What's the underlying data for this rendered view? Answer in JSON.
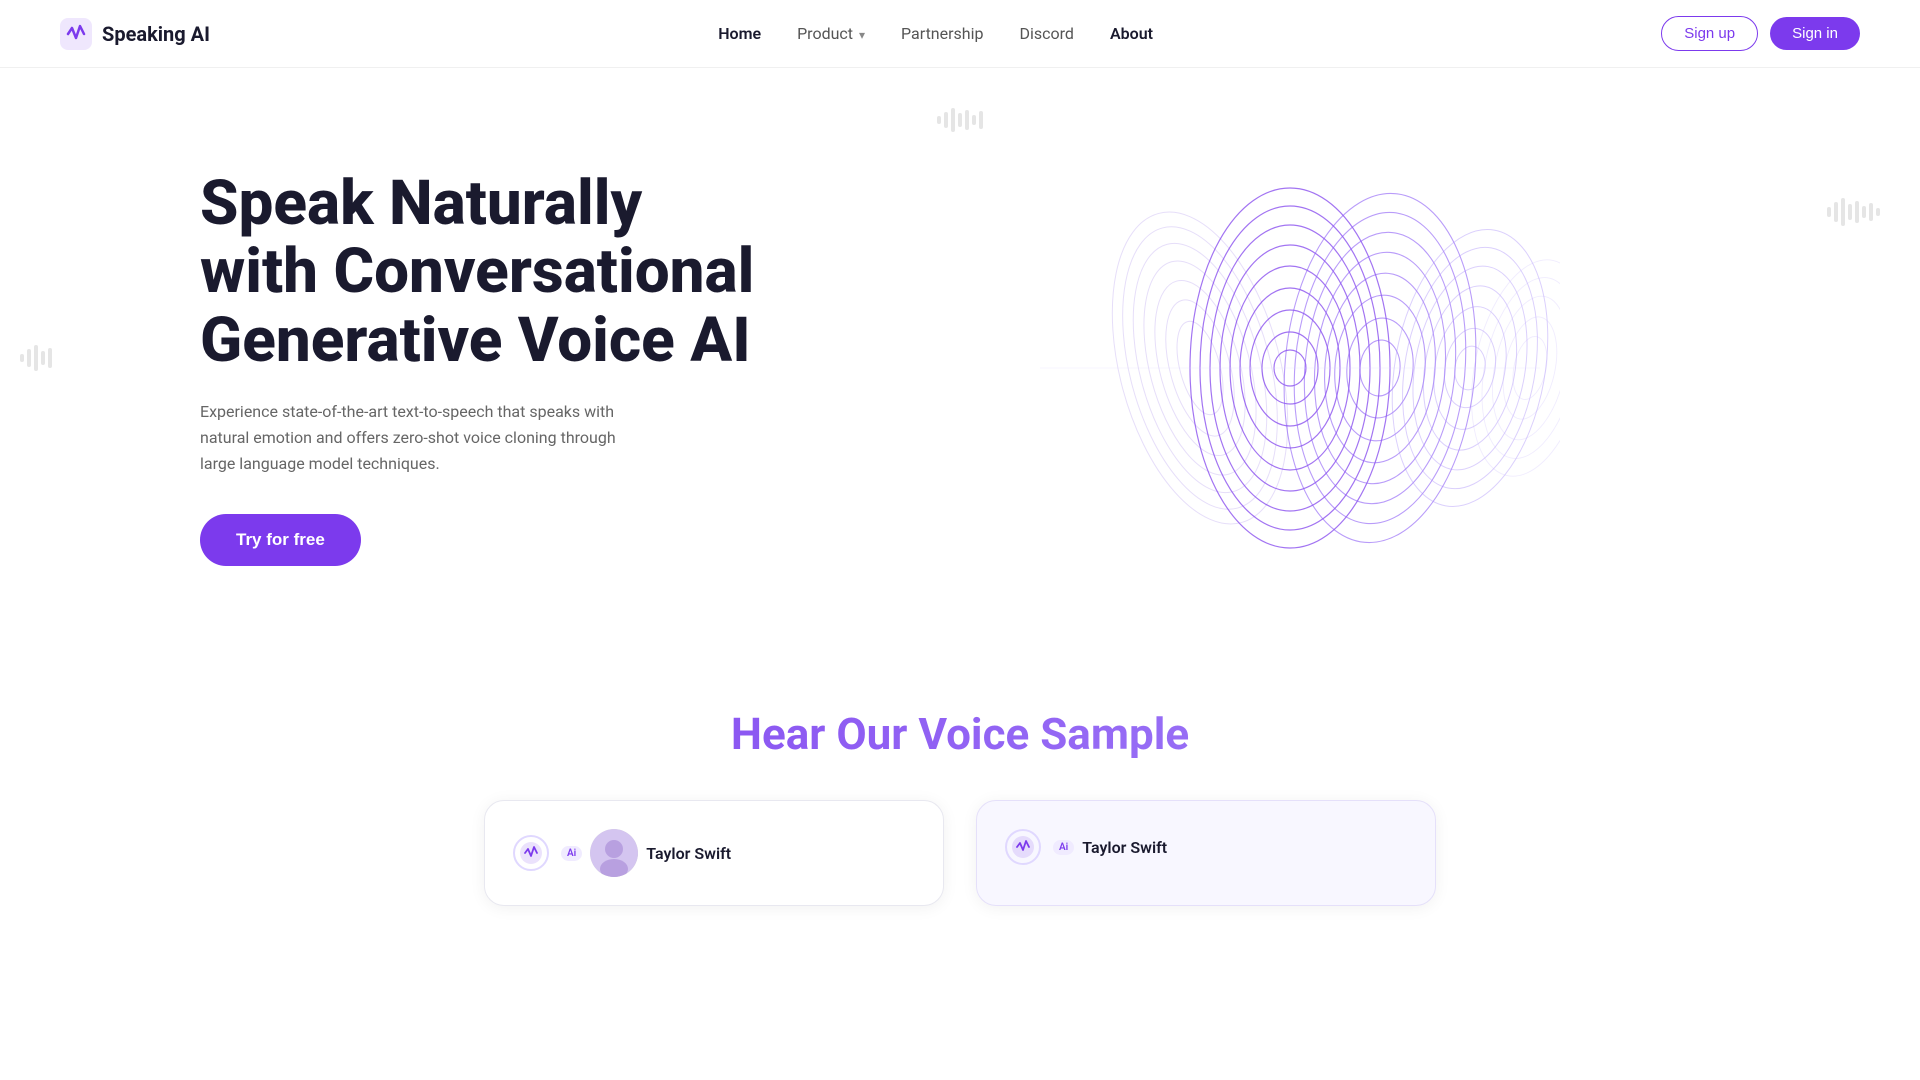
{
  "brand": {
    "name": "Speaking AI",
    "logo_alt": "Speaking AI logo"
  },
  "nav": {
    "links": [
      {
        "label": "Home",
        "active": true,
        "has_dropdown": false
      },
      {
        "label": "Product",
        "active": false,
        "has_dropdown": true
      },
      {
        "label": "Partnership",
        "active": false,
        "has_dropdown": false
      },
      {
        "label": "Discord",
        "active": false,
        "has_dropdown": false
      },
      {
        "label": "About",
        "active": false,
        "has_dropdown": false
      }
    ],
    "signup_label": "Sign up",
    "signin_label": "Sign in"
  },
  "hero": {
    "title": "Speak Naturally with Conversational Generative Voice AI",
    "description": "Experience state-of-the-art text-to-speech that speaks with natural emotion and offers zero-shot voice cloning through large language model techniques.",
    "cta_label": "Try for free"
  },
  "voice_section": {
    "title": "Hear Our Voice Sample",
    "card1": {
      "name": "Taylor Swift",
      "badge": "Ai",
      "has_avatar": true
    },
    "card2": {
      "name": "Taylor Swift",
      "badge": "Ai",
      "has_avatar": false
    }
  },
  "colors": {
    "brand_purple": "#7c3aed",
    "brand_purple_light": "#a78bfa",
    "nav_text": "#555555",
    "active_text": "#1a1a2e",
    "hero_title": "#1a1a2e",
    "hero_desc": "#666666"
  }
}
